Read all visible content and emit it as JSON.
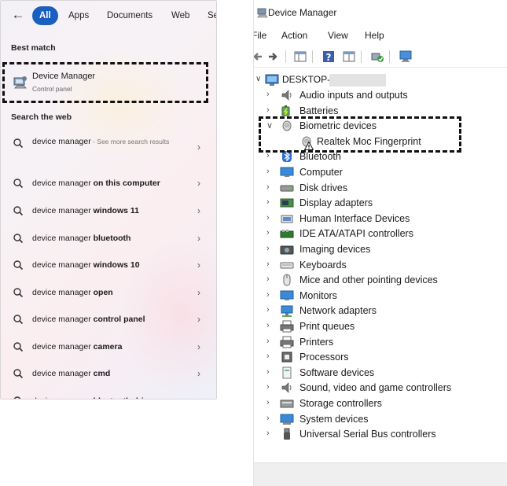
{
  "search": {
    "filters": [
      {
        "label": "All",
        "active": true
      },
      {
        "label": "Apps",
        "active": false
      },
      {
        "label": "Documents",
        "active": false
      },
      {
        "label": "Web",
        "active": false
      },
      {
        "label": "Se",
        "active": false
      }
    ],
    "best_match_heading": "Best match",
    "best_match": {
      "title": "Device Manager",
      "subtitle": "Control panel",
      "icon": "device-manager-icon"
    },
    "web_heading": "Search the web",
    "web_results": [
      {
        "prefix": "device manager",
        "bold": "",
        "extra": " - See more search results"
      },
      {
        "prefix": "device manager ",
        "bold": "on this computer",
        "extra": ""
      },
      {
        "prefix": "device manager ",
        "bold": "windows 11",
        "extra": ""
      },
      {
        "prefix": "device manager ",
        "bold": "bluetooth",
        "extra": ""
      },
      {
        "prefix": "device manager ",
        "bold": "windows 10",
        "extra": ""
      },
      {
        "prefix": "device manager ",
        "bold": "open",
        "extra": ""
      },
      {
        "prefix": "device manager ",
        "bold": "control panel",
        "extra": ""
      },
      {
        "prefix": "device manager ",
        "bold": "camera",
        "extra": ""
      },
      {
        "prefix": "device manager ",
        "bold": "cmd",
        "extra": ""
      },
      {
        "prefix": "device manager ",
        "bold": "bluetooth driver",
        "extra": ""
      }
    ]
  },
  "device_manager": {
    "title": "Device Manager",
    "menu": [
      "File",
      "Action",
      "View",
      "Help"
    ],
    "root": "DESKTOP-",
    "nodes": [
      {
        "label": "Audio inputs and outputs",
        "expanded": false,
        "icon": "speaker-icon"
      },
      {
        "label": "Batteries",
        "expanded": false,
        "icon": "battery-icon"
      },
      {
        "label": "Biometric devices",
        "expanded": true,
        "icon": "fingerprint-icon"
      },
      {
        "label": "Bluetooth",
        "expanded": false,
        "icon": "bluetooth-icon"
      },
      {
        "label": "Computer",
        "expanded": false,
        "icon": "monitor-icon"
      },
      {
        "label": "Disk drives",
        "expanded": false,
        "icon": "disk-icon"
      },
      {
        "label": "Display adapters",
        "expanded": false,
        "icon": "display-adapter-icon"
      },
      {
        "label": "Human Interface Devices",
        "expanded": false,
        "icon": "hid-icon"
      },
      {
        "label": "IDE ATA/ATAPI controllers",
        "expanded": false,
        "icon": "ide-icon"
      },
      {
        "label": "Imaging devices",
        "expanded": false,
        "icon": "camera-icon"
      },
      {
        "label": "Keyboards",
        "expanded": false,
        "icon": "keyboard-icon"
      },
      {
        "label": "Mice and other pointing devices",
        "expanded": false,
        "icon": "mouse-icon"
      },
      {
        "label": "Monitors",
        "expanded": false,
        "icon": "monitor-icon"
      },
      {
        "label": "Network adapters",
        "expanded": false,
        "icon": "network-icon"
      },
      {
        "label": "Print queues",
        "expanded": false,
        "icon": "printer-icon"
      },
      {
        "label": "Printers",
        "expanded": false,
        "icon": "printer-icon"
      },
      {
        "label": "Processors",
        "expanded": false,
        "icon": "cpu-icon"
      },
      {
        "label": "Software devices",
        "expanded": false,
        "icon": "software-device-icon"
      },
      {
        "label": "Sound, video and game controllers",
        "expanded": false,
        "icon": "speaker-icon"
      },
      {
        "label": "Storage controllers",
        "expanded": false,
        "icon": "storage-icon"
      },
      {
        "label": "System devices",
        "expanded": false,
        "icon": "system-icon"
      },
      {
        "label": "Universal Serial Bus controllers",
        "expanded": false,
        "icon": "usb-icon"
      }
    ],
    "biometric_child": {
      "label": "Realtek Moc Fingerprint",
      "icon": "fingerprint-icon",
      "status": "warning-icon"
    }
  },
  "colors": {
    "accent": "#1a5fbf",
    "highlight_dash": "#111111"
  }
}
